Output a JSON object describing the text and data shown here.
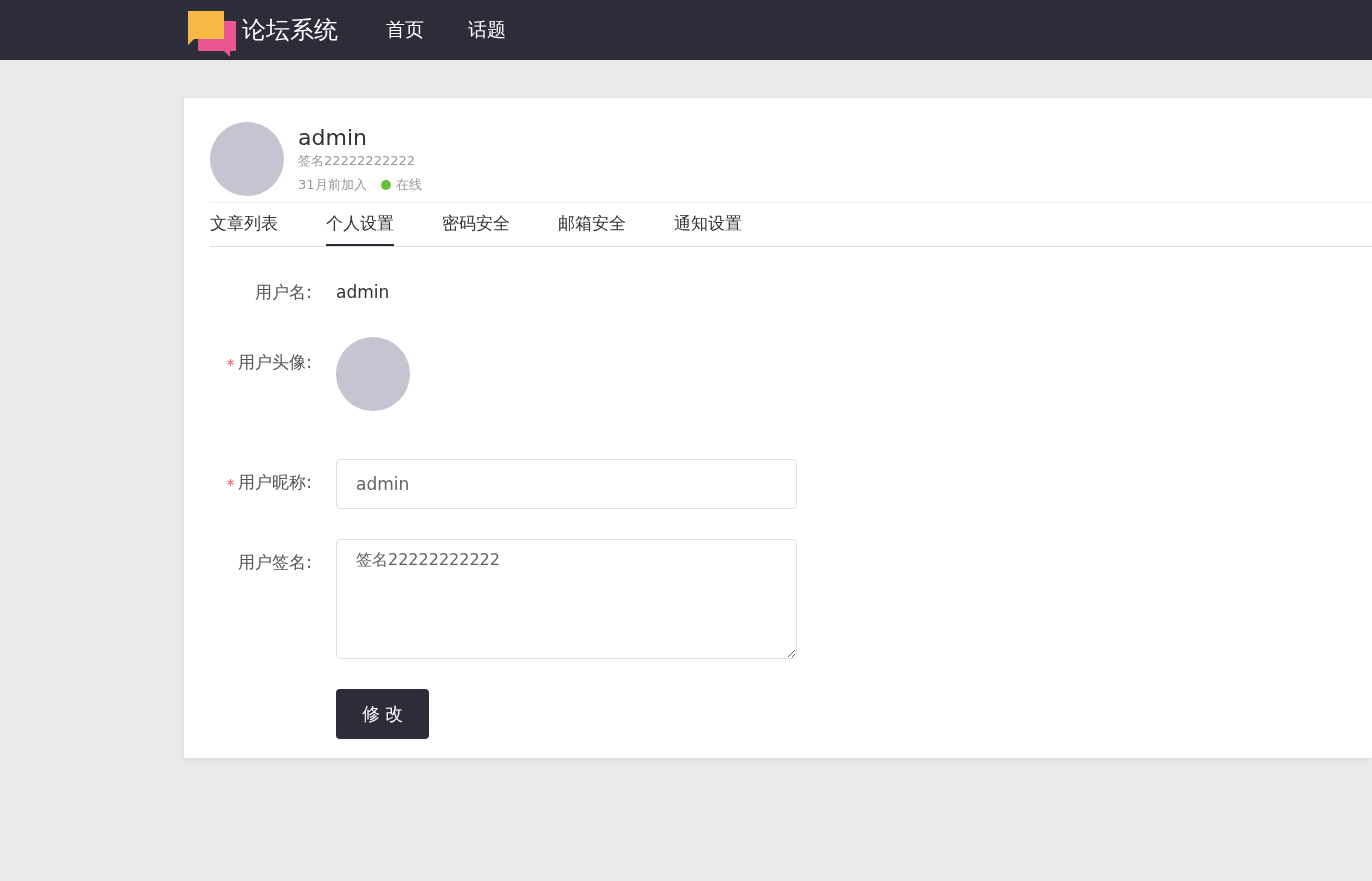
{
  "header": {
    "logo_text": "论坛系统",
    "nav": [
      {
        "label": "首页"
      },
      {
        "label": "话题"
      }
    ]
  },
  "profile": {
    "name": "admin",
    "signature": "签名22222222222",
    "joined": "31月前加入",
    "status": {
      "label": "在线",
      "color": "#67c23a"
    }
  },
  "tabs": [
    {
      "label": "文章列表",
      "selected": false
    },
    {
      "label": "个人设置",
      "selected": true
    },
    {
      "label": "密码安全",
      "selected": false
    },
    {
      "label": "邮箱安全",
      "selected": false
    },
    {
      "label": "通知设置",
      "selected": false
    }
  ],
  "form": {
    "fields": [
      {
        "kind": "text",
        "label": "用户名:",
        "required": false,
        "value": "admin"
      },
      {
        "kind": "avatar",
        "label": "用户头像:",
        "required": true
      },
      {
        "kind": "input",
        "label": "用户昵称:",
        "required": true,
        "value": "admin"
      },
      {
        "kind": "textarea",
        "label": "用户签名:",
        "required": false,
        "value": "签名22222222222"
      }
    ],
    "submit": "修 改"
  }
}
